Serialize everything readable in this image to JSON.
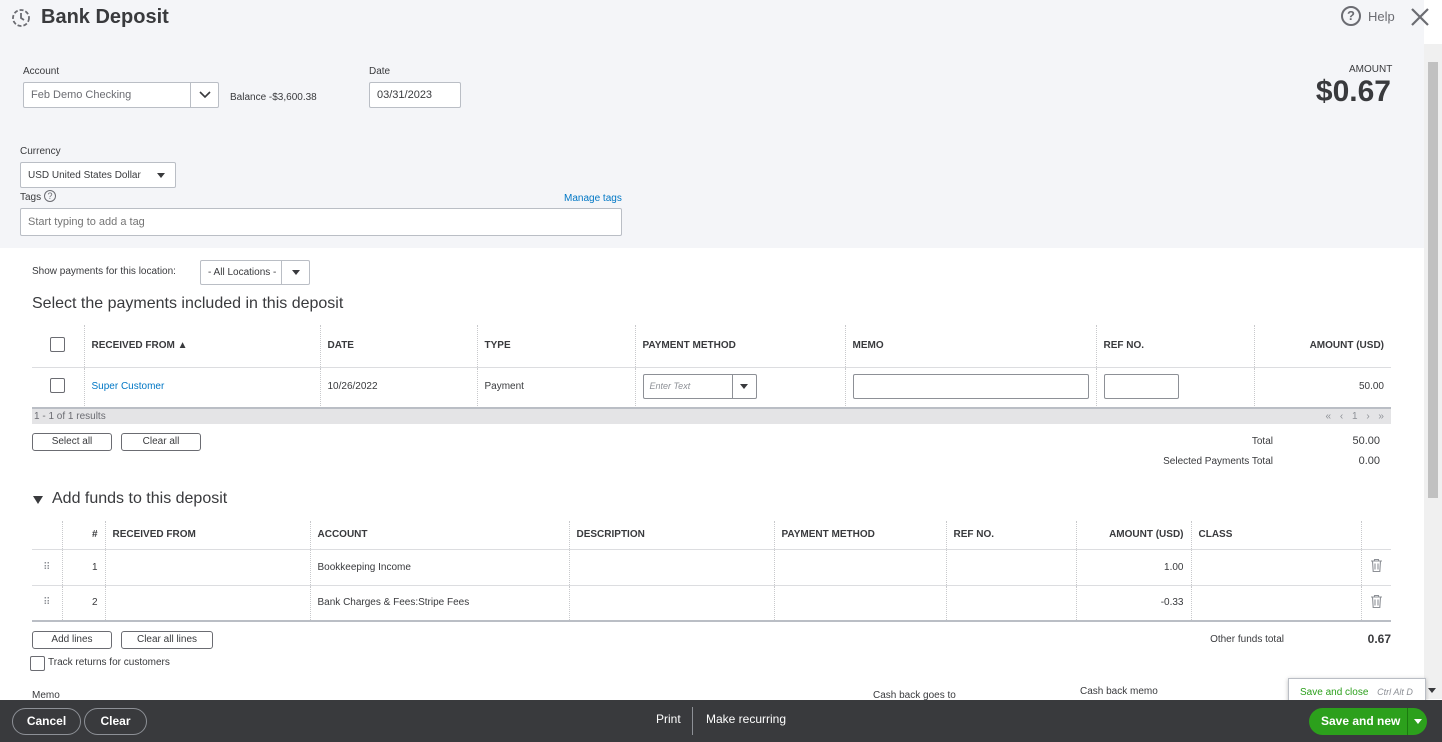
{
  "header": {
    "title": "Bank Deposit",
    "help_label": "Help"
  },
  "account": {
    "label": "Account",
    "value": "Feb Demo Checking",
    "balance": "Balance -$3,600.38"
  },
  "date": {
    "label": "Date",
    "value": "03/31/2023"
  },
  "amount": {
    "label": "AMOUNT",
    "value": "$0.67"
  },
  "currency": {
    "label": "Currency",
    "value": "USD United States Dollar"
  },
  "tags": {
    "label": "Tags",
    "manage_link": "Manage tags",
    "placeholder": "Start typing to add a tag"
  },
  "location": {
    "label": "Show payments for this location:",
    "value": "- All Locations -"
  },
  "payments": {
    "title": "Select the payments included in this deposit",
    "columns": [
      "RECEIVED FROM ▲",
      "DATE",
      "TYPE",
      "PAYMENT METHOD",
      "MEMO",
      "REF NO.",
      "AMOUNT (USD)"
    ],
    "rows": [
      {
        "received_from": "Super Customer",
        "date": "10/26/2022",
        "type": "Payment",
        "payment_method_placeholder": "Enter Text",
        "amount": "50.00"
      }
    ],
    "results_text": "1 - 1 of 1 results",
    "pager": "« ‹ 1 › »",
    "select_all": "Select all",
    "clear_all": "Clear all",
    "total_label": "Total",
    "total_value": "50.00",
    "selected_total_label": "Selected Payments Total",
    "selected_total_value": "0.00"
  },
  "funds": {
    "title": "Add funds to this deposit",
    "columns": [
      "#",
      "RECEIVED FROM",
      "ACCOUNT",
      "DESCRIPTION",
      "PAYMENT METHOD",
      "REF NO.",
      "AMOUNT (USD)",
      "CLASS"
    ],
    "rows": [
      {
        "num": "1",
        "account": "Bookkeeping Income",
        "amount": "1.00"
      },
      {
        "num": "2",
        "account": "Bank Charges & Fees:Stripe Fees",
        "amount": "-0.33"
      }
    ],
    "add_lines": "Add lines",
    "clear_all_lines": "Clear all lines",
    "other_total_label": "Other funds total",
    "other_total_value": "0.67",
    "track_returns": "Track returns for customers"
  },
  "bottom_labels": {
    "memo": "Memo",
    "cash_back_goes_to": "Cash back goes to",
    "cash_back_memo": "Cash back memo"
  },
  "footer": {
    "cancel": "Cancel",
    "clear": "Clear",
    "print": "Print",
    "make_recurring": "Make recurring",
    "save_and_new": "Save and new",
    "save_and_close": "Save and close",
    "save_and_close_shortcut": "Ctrl Alt D"
  },
  "colors": {
    "accent_green": "#2ca01c",
    "link_blue": "#0077c5",
    "footer_bg": "#393a3d"
  }
}
